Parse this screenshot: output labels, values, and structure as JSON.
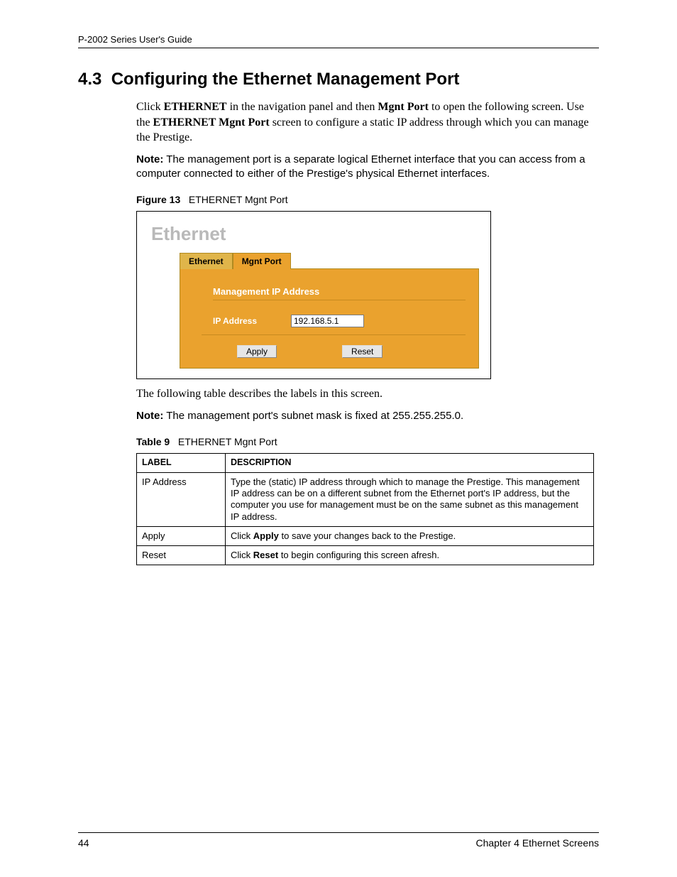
{
  "header": {
    "guide_title": "P-2002 Series User's Guide"
  },
  "section": {
    "number": "4.3",
    "title": "Configuring the Ethernet Management Port"
  },
  "intro": {
    "p1_pre": "Click ",
    "p1_b1": "ETHERNET",
    "p1_mid1": " in the navigation panel and then ",
    "p1_b2": "Mgnt Port",
    "p1_mid2": " to open the following screen. Use the ",
    "p1_b3": "ETHERNET Mgnt Port",
    "p1_post": " screen to configure a static IP address through which you can manage the Prestige.",
    "note_label": "Note:",
    "note_text": " The management port is a separate logical Ethernet interface that you can access from a computer connected to either of the Prestige's physical Ethernet interfaces."
  },
  "figure": {
    "label": "Figure 13",
    "caption": "ETHERNET Mgnt Port",
    "app_title": "Ethernet",
    "tab_ethernet": "Ethernet",
    "tab_mgnt": "Mgnt Port",
    "section_label": "Management IP Address",
    "ip_label": "IP Address",
    "ip_value": "192.168.5.1",
    "apply_label": "Apply",
    "reset_label": "Reset"
  },
  "post_figure": {
    "p1": "The following table describes the labels in this screen.",
    "note_label": "Note:",
    "note_text": " The management port's subnet mask is fixed at 255.255.255.0."
  },
  "table": {
    "label": "Table 9",
    "caption": "ETHERNET Mgnt Port",
    "head_label": "LABEL",
    "head_desc": "DESCRIPTION",
    "rows": [
      {
        "label": "IP Address",
        "desc": "Type the (static) IP address through which to manage the Prestige. This management IP address can be on a different subnet from the Ethernet port's IP address, but the computer you use for management must be on the same subnet as this management IP address."
      },
      {
        "label": "Apply",
        "desc_pre": "Click ",
        "desc_b": "Apply",
        "desc_post": " to save your changes back to the Prestige."
      },
      {
        "label": "Reset",
        "desc_pre": "Click ",
        "desc_b": "Reset",
        "desc_post": " to begin configuring this screen afresh."
      }
    ]
  },
  "footer": {
    "page_number": "44",
    "chapter": "Chapter 4 Ethernet Screens"
  }
}
